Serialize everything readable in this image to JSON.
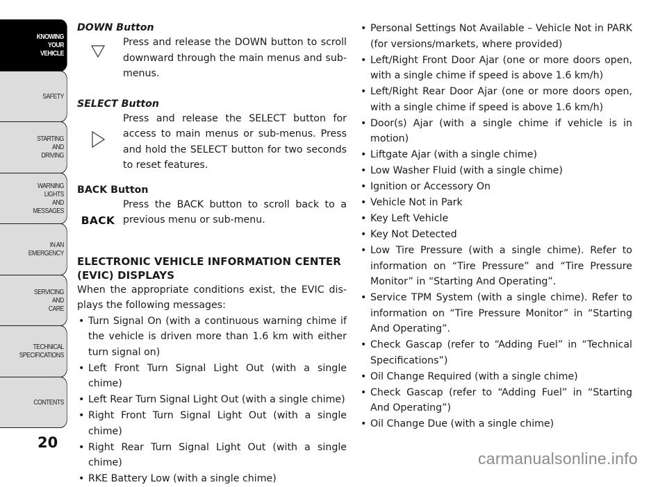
{
  "sidebar": {
    "tabs": [
      {
        "label": "KNOWING\nYOUR\nVEHICLE",
        "active": true
      },
      {
        "label": "SAFETY"
      },
      {
        "label": "STARTING\nAND\nDRIVING"
      },
      {
        "label": "WARNING\nLIGHTS\nAND\nMESSAGES"
      },
      {
        "label": "IN AN\nEMERGENCY"
      },
      {
        "label": "SERVICING\nAND\nCARE"
      },
      {
        "label": "TECHNICAL\nSPECIFICATIONS"
      },
      {
        "label": "CONTENTS"
      }
    ]
  },
  "page_number": "20",
  "buttons": [
    {
      "title": "DOWN Button",
      "icon": "down-triangle-icon",
      "text": "Press and release the DOWN button to scroll downward through the main menus and sub-menus."
    },
    {
      "title": "SELECT Button",
      "icon": "right-triangle-icon",
      "text": "Press and release the SELECT button for access to main menus or sub-menus. Press and hold the SELECT button for two seconds to reset features."
    },
    {
      "title": "BACK Button",
      "icon_text": "BACK",
      "text": "Press the BACK button to scroll back to a previous menu or sub-menu."
    }
  ],
  "section": {
    "heading": "ELECTRONIC VEHICLE INFORMATION CENTER (EVIC) DISPLAYS",
    "intro": "When the appropriate conditions exist, the EVIC dis-plays the following messages:",
    "left_bullets": [
      "Turn Signal On (with a continuous warning chime if the vehicle is driven more than 1.6 km with either turn signal on)",
      "Left Front Turn Signal Light Out (with a single chime)",
      "Left Rear Turn Signal Light Out (with a single chime)",
      "Right Front Turn Signal Light Out (with a single chime)",
      "Right Rear Turn Signal Light Out (with a single chime)",
      "RKE Battery Low (with a single chime)"
    ],
    "right_bullets": [
      "Personal Settings Not Available – Vehicle Not in PARK (for versions/markets, where provided)",
      "Left/Right Front Door Ajar (one or more doors open, with a single chime if speed is above 1.6 km/h)",
      "Left/Right Rear Door Ajar (one or more doors open, with a single chime if speed is above 1.6 km/h)",
      "Door(s) Ajar (with a single chime if vehicle is in motion)",
      "Liftgate Ajar (with a single chime)",
      "Low Washer Fluid (with a single chime)",
      "Ignition or Accessory On",
      "Vehicle Not in Park",
      "Key Left Vehicle",
      "Key Not Detected",
      "Low Tire Pressure (with a single chime). Refer to information on “Tire Pressure” and “Tire Pressure Monitor” in “Starting And Operating”.",
      "Service TPM System (with a single chime). Refer to information on “Tire Pressure Monitor” in “Starting And Operating”.",
      "Check Gascap (refer to “Adding Fuel” in “Technical Specifications”)",
      "Oil Change Required (with a single chime)",
      "Check Gascap (refer to “Adding Fuel” in “Starting And Operating”)",
      "Oil Change Due (with a single chime)"
    ]
  },
  "watermark": "carmanualsonline.info"
}
